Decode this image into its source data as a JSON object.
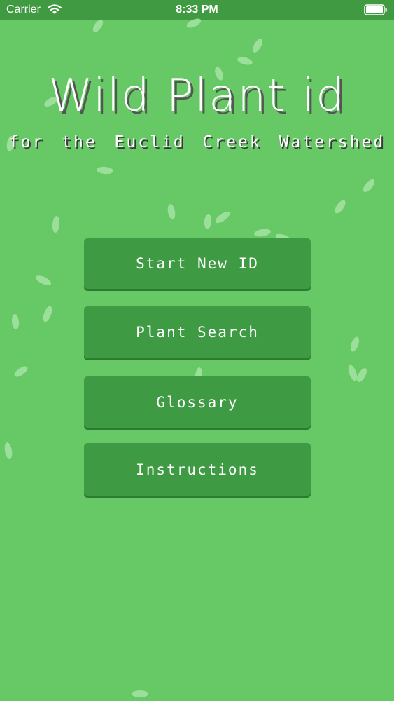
{
  "status_bar": {
    "carrier": "Carrier",
    "time": "8:33 PM",
    "wifi_icon": "wifi-icon",
    "battery_icon": "battery-icon"
  },
  "app": {
    "title": "Wild Plant id",
    "subtitle": "for the Euclid Creek Watershed"
  },
  "menu": {
    "start_new_id": "Start New ID",
    "plant_search": "Plant Search",
    "glossary": "Glossary",
    "instructions": "Instructions"
  },
  "colors": {
    "background": "#66c966",
    "status_bar": "#3f9a42",
    "button": "#3f9b43",
    "leaf": "#a6e3a6"
  }
}
